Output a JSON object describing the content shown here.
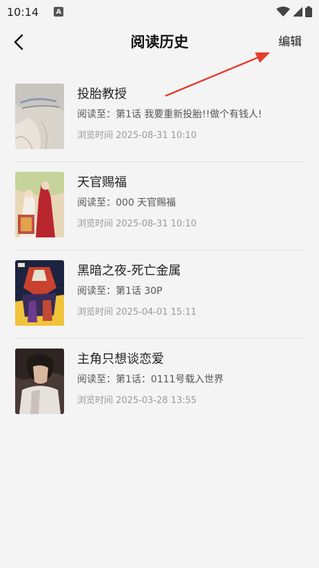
{
  "status_bar": {
    "time": "10:14",
    "notification_icon": "A",
    "icons": [
      "wifi-icon",
      "signal-icon",
      "battery-icon"
    ]
  },
  "header": {
    "back_icon": "chevron-left-icon",
    "title": "阅读历史",
    "edit_label": "编辑"
  },
  "annotation": {
    "color": "#e83a2e"
  },
  "history": [
    {
      "title": "投胎教授",
      "progress": "阅读至：第1话 我要重新投胎!!做个有钱人!",
      "time": "浏览时间 2025-08-31 10:10"
    },
    {
      "title": "天官赐福",
      "progress": "阅读至：000 天官赐福",
      "time": "浏览时间 2025-08-31 10:10"
    },
    {
      "title": "黑暗之夜-死亡金属",
      "progress": "阅读至：第1话 30P",
      "time": "浏览时间 2025-04-01 15:11"
    },
    {
      "title": "主角只想谈恋爱",
      "progress": "阅读至：第1话：0111号载入世界",
      "time": "浏览时间 2025-03-28 13:55"
    }
  ]
}
